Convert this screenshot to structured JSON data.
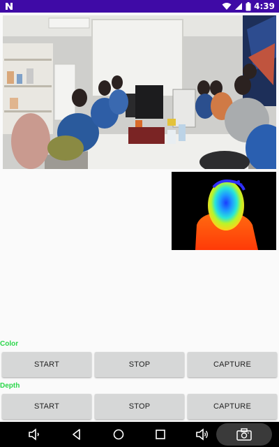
{
  "status_bar": {
    "time": "4:39",
    "icons": [
      "app-logo-icon",
      "wifi-icon",
      "signal-icon",
      "battery-icon"
    ]
  },
  "color_section": {
    "label": "Color",
    "start_label": "START",
    "stop_label": "STOP",
    "capture_label": "CAPTURE"
  },
  "depth_section": {
    "label": "Depth",
    "start_label": "START",
    "stop_label": "STOP",
    "capture_label": "CAPTURE"
  },
  "nav_bar": {
    "icons": [
      "volume-down-icon",
      "back-icon",
      "home-icon",
      "recents-icon",
      "volume-up-icon",
      "screenshot-icon"
    ]
  },
  "colors": {
    "status_bar": "#3f0aa6",
    "section_label": "#2bd64a",
    "button_bg": "#d6d7d7",
    "nav_bar": "#000000"
  }
}
